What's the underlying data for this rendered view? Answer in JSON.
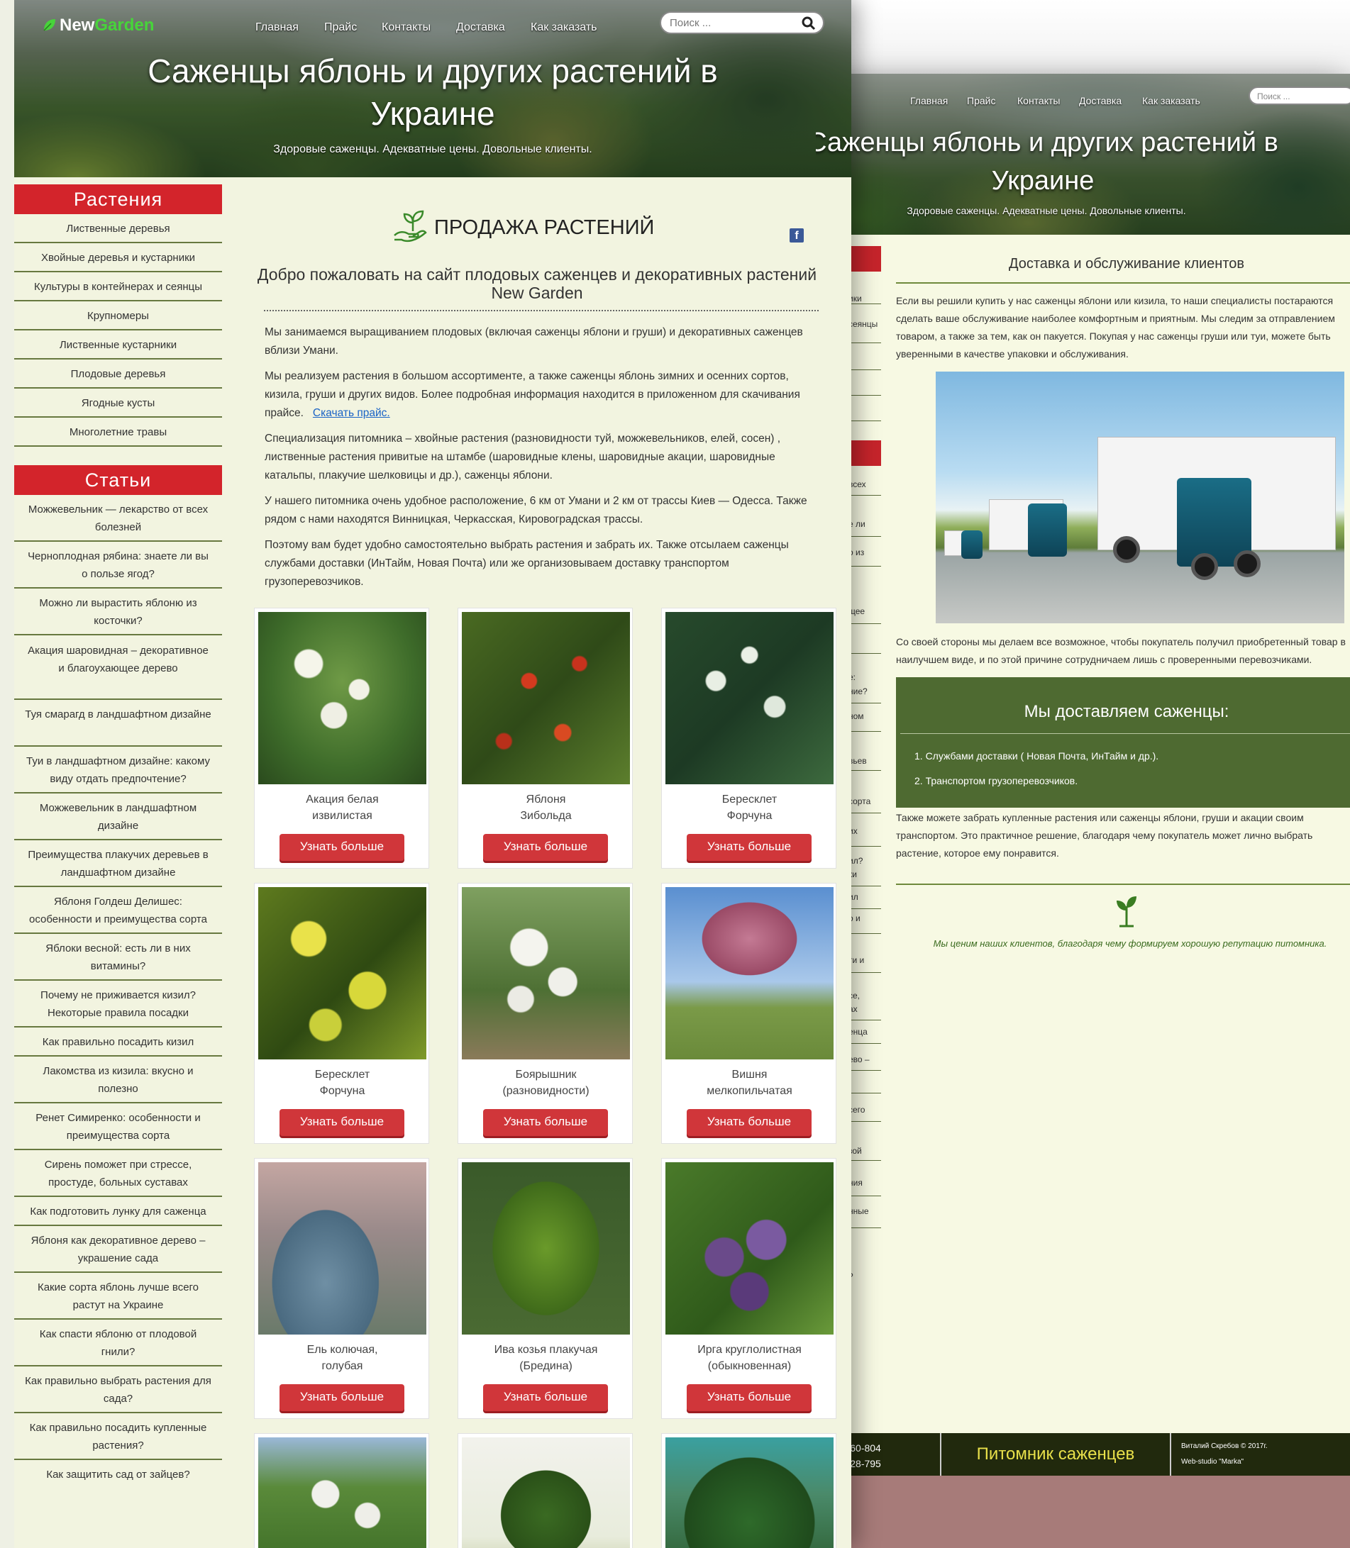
{
  "front": {
    "logo": {
      "new": "New",
      "garden": "Garden"
    },
    "nav": [
      "Главная",
      "Прайс",
      "Контакты",
      "Доставка",
      "Как заказать"
    ],
    "search_placeholder": "Поиск ...",
    "title": "Саженцы яблонь и других растений в Украине",
    "subtitle": "Здоровые саженцы. Адекватные цены. Довольные клиенты.",
    "sidebar": {
      "plants_title": "Растения",
      "plants": [
        "Лиственные деревья",
        "Хвойные деревья и кустарники",
        "Культуры в контейнерах и сеянцы",
        "Крупномеры",
        "Лиственные кустарники",
        "Плодовые деревья",
        "Ягодные кусты",
        "Многолетние травы"
      ],
      "articles_title": "Статьи",
      "articles": [
        "Можжевельник — лекарство от всех болезней",
        "Черноплодная рябина: знаете ли вы о пользе ягод?",
        "Можно ли вырастить яблоню из косточки?",
        "Акация шаровидная – декоративное и благоухающее дерево",
        "Туя смарагд в ландшафтном дизайне",
        "Туи в ландшафтном дизайне: какому виду отдать предпочтение?",
        "Можжевельник в ландшафтном дизайне",
        "Преимущества плакучих деревьев в ландшафтном дизайне",
        "Яблоня Голдеш Делишес: особенности и преимущества сорта",
        "Яблоки весной: есть ли в них витамины?",
        "Почему не приживается кизил? Некоторые правила посадки",
        "Как правильно посадить кизил",
        "Лакомства из кизила: вкусно и полезно",
        "Ренет Симиренко: особенности и преимущества сорта",
        "Сирень поможет при стрессе, простуде, больных суставах",
        "Как подготовить лунку для саженца",
        "Яблоня как декоративное дерево – украшение сада",
        "Какие сорта яблонь лучше всего растут на Украине",
        "Как спасти яблоню от плодовой гнили?",
        "Как правильно выбрать растения для сада?",
        "Как правильно посадить купленные растения?",
        "Как защитить сад от зайцев?"
      ]
    },
    "sale_heading": "ПРОДАЖА РАСТЕНИЙ",
    "fb_icon": "facebook-icon",
    "welcome": "Добро пожаловать на сайт плодовых саженцев и декоративных растений New Garden",
    "paragraphs": [
      "Мы занимаемся выращиванием плодовых (включая саженцы яблони и груши) и декоративных саженцев вблизи Умани.",
      "Мы реализуем растения в большом ассортименте, а также саженцы яблонь зимних и осенних сортов, кизила, груши и других видов. Более подробная информация находится в приложенном для скачивания прайсе.",
      "Специализация питомника – хвойные растения (разновидности туй, можжевельников, елей, сосен) ,  лиственные  растения привитые на штамбе (шаровидные клены, шаровидные акации,  шаровидные катальпы, плакучие шелковицы и др.), саженцы яблони.",
      "У нашего питомника очень удобное расположение, 6 км от Умани и 2 км от трассы Киев — Одесса. Также рядом с нами находятся Винницкая, Черкасская, Кировоградская трассы.",
      "Поэтому вам будет удобно самостоятельно выбрать растения и забрать их. Также отсылаем саженцы  службами доставки (ИнТайм, Новая Почта) или же организовываем доставку транспортом грузоперевозчиков."
    ],
    "download_link": "Скачать прайс.",
    "more_label": "Узнать больше",
    "products": [
      {
        "line1": "Акация белая",
        "line2": "извилистая"
      },
      {
        "line1": "Яблоня",
        "line2": "Зибольда"
      },
      {
        "line1": "Бересклет",
        "line2": "Форчуна"
      },
      {
        "line1": "Бересклет",
        "line2": "Форчуна"
      },
      {
        "line1": "Боярышник",
        "line2": "(разновидности)"
      },
      {
        "line1": "Вишня",
        "line2": "мелкопильчатая"
      },
      {
        "line1": "Ель колючая,",
        "line2": "голубая"
      },
      {
        "line1": "Ива козья плакучая",
        "line2": "(Бредина)"
      },
      {
        "line1": "Ирга круглолистная",
        "line2": "(обыкновенная)"
      }
    ]
  },
  "back": {
    "nav": [
      "Главная",
      "Прайс",
      "Контакты",
      "Доставка",
      "Как заказать"
    ],
    "search_placeholder": "Поиск ...",
    "title": "Саженцы яблонь и других растений в Украине",
    "subtitle": "Здоровые саженцы. Адекватные цены. Довольные клиенты.",
    "sidebar_fragments": [
      "ики",
      "сеянцы",
      "всех",
      "е ли",
      "о из",
      "щее",
      "е:",
      "ние?",
      "ном",
      "вьев",
      "сорта",
      "их",
      "ил?",
      "ки",
      "ил",
      "о и",
      "ти и",
      "се,",
      "ах",
      "енца",
      "ево –",
      "сего",
      "зой",
      "ния",
      "нные",
      "?"
    ],
    "heading": "Доставка и обслуживание клиентов",
    "p1": [
      "Если вы решили купить у нас саженцы яблони или кизила, то наши специалисты постараются",
      "сделать ваше обслуживание  наиболее комфортным и приятным. Мы следим за отправлением",
      "товаром, а также за тем, как он пакуется. Покупая у нас саженцы груши или туи, можете быть",
      "уверенными в качестве упаковки и обслуживания."
    ],
    "p2": [
      "Со своей стороны мы делаем все возможное, чтобы покупатель получил приобретенный товар в",
      "наилучшем виде, и по этой причине сотрудничаем лишь с проверенными перевозчиками."
    ],
    "delivery_title": "Мы доставляем саженцы:",
    "delivery_items": [
      "1. Службами доставки ( Новая Почта, ИнТайм и др.).",
      "2. Транспортом грузоперевозчиков."
    ],
    "p3": [
      "Также  можете забрать купленные растения или саженцы яблони, груши и акации своим",
      "транспортом. Это практичное решение, благодаря чему покупатель может лично выбрать",
      "растение, которое ему понравится."
    ],
    "quote": "Мы ценим наших клиентов, благодаря чему формируем хорошую репутацию питомника.",
    "footer": {
      "phone1": "063-61-60-804",
      "phone2": "097-59-28-795",
      "brand": "Питомник саженцев",
      "copyright": "Виталий Скребов © 2017г.",
      "studio": "Web-studio \"Marka\""
    }
  }
}
